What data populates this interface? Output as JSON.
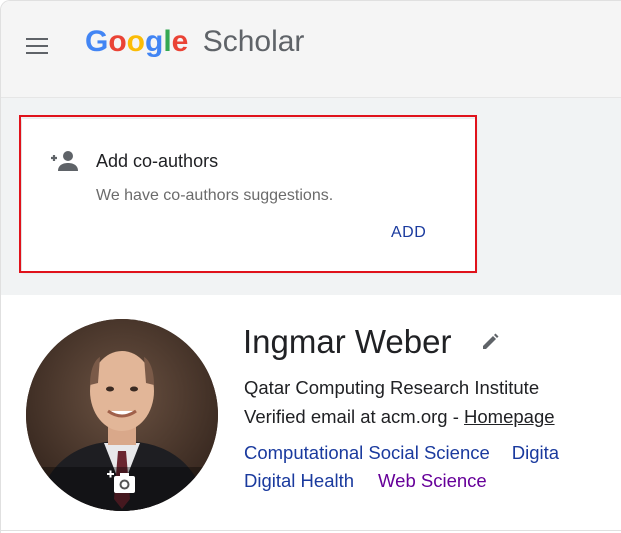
{
  "header": {
    "logo_google_letters": [
      "G",
      "o",
      "o",
      "g",
      "l",
      "e"
    ],
    "logo_colors": [
      "#4285f4",
      "#ea4335",
      "#fbbc05",
      "#4285f4",
      "#34a853",
      "#ea4335"
    ],
    "logo_scholar": "Scholar"
  },
  "card": {
    "title": "Add co-authors",
    "subtitle": "We have co-authors suggestions.",
    "add_label": "ADD",
    "icon": "person-add-icon"
  },
  "profile": {
    "name": "Ingmar Weber",
    "affiliation": "Qatar Computing Research Institute",
    "email_text": "Verified email at acm.org - ",
    "homepage_label": "Homepage",
    "interests": [
      "Computational Social Science",
      "Digita",
      "Digital Health",
      "Web Science"
    ]
  },
  "colors": {
    "link": "#1a3a9e",
    "visited_link": "#660099",
    "highlight": "#e0121b",
    "header_bg": "#f5f5f5"
  }
}
